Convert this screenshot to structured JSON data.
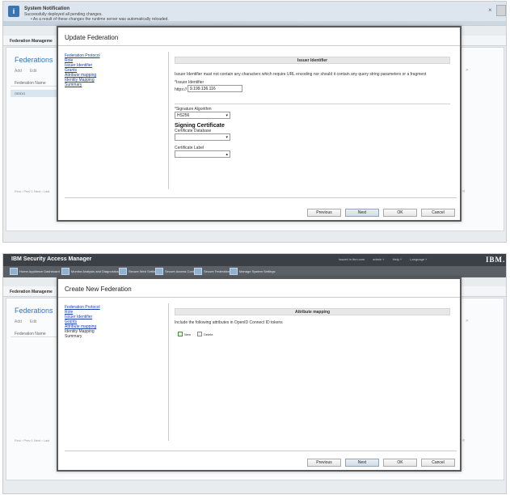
{
  "panel1": {
    "notification": {
      "title": "System Notification",
      "message": "Successfully deployed all pending changes.",
      "detail": "• As a result of these changes the runtime server was automatically reloaded.",
      "close": "×"
    },
    "sub_header": "Federation Manageme",
    "heading": "Federations",
    "toolbar": {
      "add": "Add",
      "edit": "Edit"
    },
    "col_header": "Federation Name",
    "row": "OIDDO",
    "footer": "First ‹ Prev 1 Next › Last",
    "dialog": {
      "title": "Update Federation",
      "nav": [
        "Federation Protocol",
        "Role",
        "Issuer Identifier",
        "Grants",
        "Attribute mapping",
        "Identity Mapping",
        "Summary"
      ],
      "section_title": "Issuer Identifier",
      "instruction": "Issuer Identifier must not contain any characters which require URL encoding nor should it contain any query string parameters or a fragment",
      "issuer_label": "*Issuer Identifier",
      "prefix": "https://",
      "issuer_value": "9.199.136.116",
      "sig_alg_label": "*Signature Algorithm",
      "sig_alg_value": "HS256",
      "signing_title": "Signing Certificate",
      "cert_db_label": "Certificate Database",
      "cert_label_label": "Certificate Label",
      "buttons": {
        "previous": "Previous",
        "next": "Next",
        "ok": "OK",
        "cancel": "Cancel"
      }
    }
  },
  "panel2": {
    "brand": "IBM Security Access Manager",
    "top_links": [
      "Issued in ibm.com",
      "admin ˅",
      "Help ˅",
      "Language ˅"
    ],
    "ibm_logo": "IBM.",
    "menu": [
      "Home Appliance Dashboard",
      "Monitor Analysis and Diagnostics",
      "Secure Web Settings",
      "Secure Access Control",
      "Secure Federation",
      "Manage System Settings"
    ],
    "sub_header": "Federation Manageme",
    "heading": "Federations",
    "toolbar": {
      "add": "Add",
      "edit": "Edit"
    },
    "col_header": "Federation Name",
    "footer": "First ‹ Prev 1 Next › Last",
    "dialog": {
      "title": "Create New Federation",
      "nav": [
        "Federation Protocol",
        "Role",
        "Issuer Identifier",
        "Grants",
        "Attribute mapping",
        "Identity Mapping",
        "Summary"
      ],
      "section_title": "Attribute mapping",
      "instruction": "Include the following attributes in OpenID Connect ID tokens",
      "new_btn": "New",
      "delete_btn": "Delete",
      "buttons": {
        "previous": "Previous",
        "next": "Next",
        "ok": "OK",
        "cancel": "Cancel"
      }
    }
  }
}
